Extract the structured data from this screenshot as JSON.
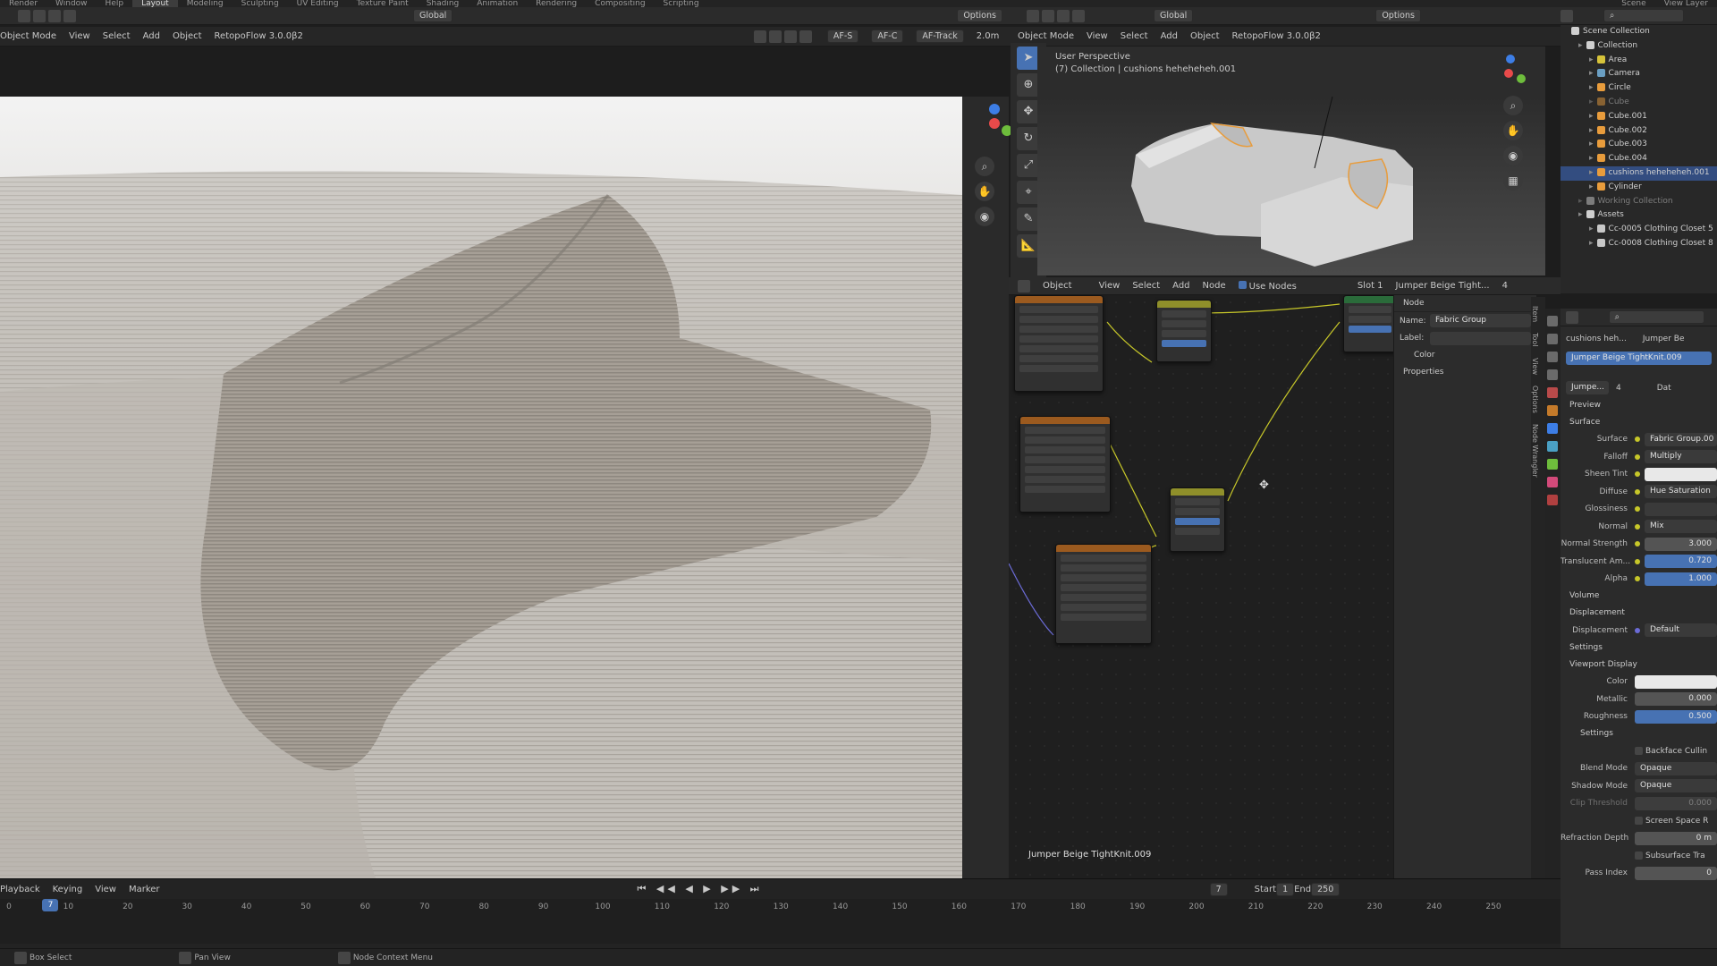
{
  "topbar": {
    "tabs": [
      "Render",
      "Window",
      "Help",
      "Layout",
      "Modeling",
      "Sculpting",
      "UV Editing",
      "Texture Paint",
      "Shading",
      "Animation",
      "Rendering",
      "Compositing",
      "Scripting"
    ],
    "scene": "Scene",
    "view_layer": "View Layer"
  },
  "left_viewport": {
    "mode": "Object Mode",
    "menus": [
      "View",
      "Select",
      "Add",
      "Object"
    ],
    "addon": "RetopoFlow 3.0.0β2",
    "orientation": "Global",
    "options": "Options",
    "af_s": "AF-S",
    "af_c": "AF-C",
    "af_track": "AF-Track",
    "distance": "2.0m"
  },
  "right_viewport": {
    "mode": "Object Mode",
    "menus": [
      "View",
      "Select",
      "Add",
      "Object"
    ],
    "addon": "RetopoFlow 3.0.0β2",
    "orientation": "Global",
    "options": "Options",
    "perspective": "User Perspective",
    "collection_info": "(7) Collection | cushions heheheheh.001"
  },
  "node_editor": {
    "editor_type": "Object",
    "menus": [
      "View",
      "Select",
      "Add",
      "Node"
    ],
    "use_nodes": "Use Nodes",
    "slot": "Slot 1",
    "material": "Jumper Beige Tight...",
    "user_count": "4",
    "footer": "Jumper Beige TightKnit.009"
  },
  "node_panel": {
    "title": "Node",
    "name_label": "Name:",
    "name_value": "Fabric Group",
    "label_label": "Label:",
    "color_label": "Color",
    "properties_label": "Properties",
    "tabs": [
      "Item",
      "Tool",
      "View",
      "Options",
      "Node Wrangler"
    ]
  },
  "outliner": {
    "items": [
      {
        "label": "Scene Collection",
        "indent": 0,
        "type": "root"
      },
      {
        "label": "Collection",
        "indent": 1,
        "type": "coll"
      },
      {
        "label": "Area",
        "indent": 2,
        "type": "light"
      },
      {
        "label": "Camera",
        "indent": 2,
        "type": "cam"
      },
      {
        "label": "Circle",
        "indent": 2,
        "type": "obj"
      },
      {
        "label": "Cube",
        "indent": 2,
        "type": "obj",
        "dim": true
      },
      {
        "label": "Cube.001",
        "indent": 2,
        "type": "obj"
      },
      {
        "label": "Cube.002",
        "indent": 2,
        "type": "obj"
      },
      {
        "label": "Cube.003",
        "indent": 2,
        "type": "obj"
      },
      {
        "label": "Cube.004",
        "indent": 2,
        "type": "obj"
      },
      {
        "label": "cushions heheheheh.001",
        "indent": 2,
        "type": "obj",
        "selected": true
      },
      {
        "label": "Cylinder",
        "indent": 2,
        "type": "obj"
      },
      {
        "label": "Working Collection",
        "indent": 1,
        "type": "coll",
        "dim": true
      },
      {
        "label": "Assets",
        "indent": 1,
        "type": "coll"
      },
      {
        "label": "Cc-0005 Clothing Closet 5",
        "indent": 2,
        "type": "asset"
      },
      {
        "label": "Cc-0008 Clothing Closet 8",
        "indent": 2,
        "type": "asset"
      }
    ]
  },
  "properties": {
    "object_name": "cushions heh...",
    "material_tab": "Jumper Be",
    "material_slot": "Jumper Beige TightKnit.009",
    "material_short": "Jumpe...",
    "users": "4",
    "data_label": "Dat",
    "preview": "Preview",
    "surface": "Surface",
    "rows": [
      {
        "label": "Surface",
        "value": "Fabric Group.00",
        "dot": true,
        "style": "dark"
      },
      {
        "label": "Falloff",
        "value": "Multiply",
        "dot": true,
        "style": "dark"
      },
      {
        "label": "Sheen Tint",
        "value": "",
        "dot": true,
        "style": "white"
      },
      {
        "label": "Diffuse",
        "value": "Hue Saturation",
        "dot": true,
        "style": "dark"
      },
      {
        "label": "Glossiness",
        "value": "",
        "dot": true,
        "style": "dark"
      },
      {
        "label": "Normal",
        "value": "Mix",
        "dot": true,
        "style": "dark"
      },
      {
        "label": "Normal Strength",
        "value": "3.000",
        "dot": true,
        "style": "num"
      },
      {
        "label": "Translucent Am...",
        "value": "0.720",
        "dot": true,
        "style": "blue"
      },
      {
        "label": "Alpha",
        "value": "1.000",
        "dot": true,
        "style": "blue"
      }
    ],
    "volume": "Volume",
    "displacement": "Displacement",
    "displacement_label": "Displacement",
    "displacement_value": "Default",
    "settings": "Settings",
    "viewport_display": "Viewport Display",
    "vd_rows": [
      {
        "label": "Color",
        "value": "",
        "style": "white"
      },
      {
        "label": "Metallic",
        "value": "0.000",
        "style": "num"
      },
      {
        "label": "Roughness",
        "value": "0.500",
        "style": "blue"
      }
    ],
    "settings2": "Settings",
    "backface": "Backface Cullin",
    "blend_mode_label": "Blend Mode",
    "blend_mode": "Opaque",
    "shadow_mode_label": "Shadow Mode",
    "shadow_mode": "Opaque",
    "clip_label": "Clip Threshold",
    "clip_value": "0.000",
    "screen_space": "Screen Space R",
    "refraction_label": "Refraction Depth",
    "refraction_value": "0 m",
    "subsurface": "Subsurface Tra",
    "pass_label": "Pass Index",
    "pass_value": "0"
  },
  "timeline": {
    "menus": [
      "Playback",
      "Keying",
      "View",
      "Marker"
    ],
    "current_frame": "7",
    "start_label": "Start",
    "start": "1",
    "end_label": "End",
    "end": "250",
    "ticks": [
      "0",
      "10",
      "20",
      "30",
      "40",
      "50",
      "60",
      "70",
      "80",
      "90",
      "100",
      "110",
      "120",
      "130",
      "140",
      "150",
      "160",
      "170",
      "180",
      "190",
      "200",
      "210",
      "220",
      "230",
      "240",
      "250"
    ],
    "playhead": "7"
  },
  "status": {
    "items": [
      "Box Select",
      "Pan View",
      "Node Context Menu"
    ]
  }
}
